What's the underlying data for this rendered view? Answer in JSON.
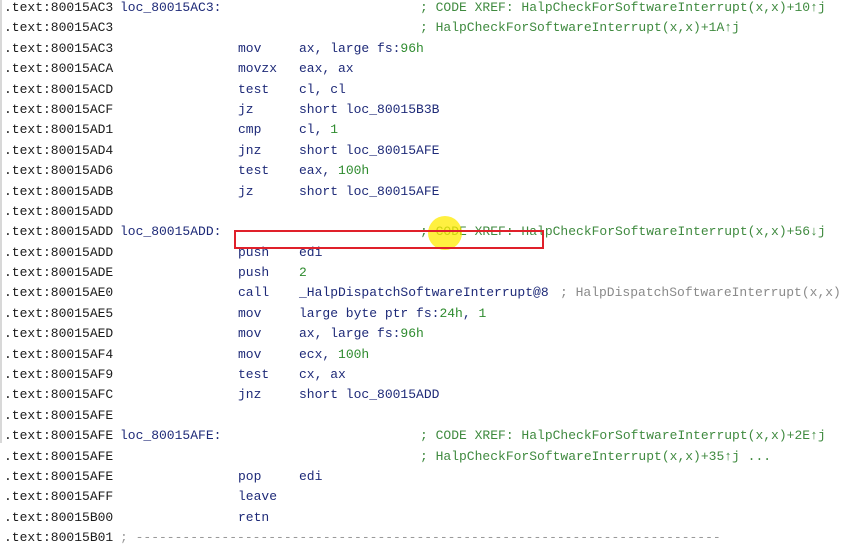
{
  "colors": {
    "address": "#1a1a1a",
    "mnemonic": "#1e2a78",
    "number": "#2e8b2e",
    "comment": "#3f8a3f",
    "highlight_box": "#e0202a",
    "cursor_highlight": "#ffeb00"
  },
  "lines": [
    {
      "addr": ".text:80015AC3",
      "label": "loc_80015AC3:",
      "mnem": "",
      "ops": [],
      "comment": "; CODE XREF: HalpCheckForSoftwareInterrupt(x,x)+10↑j"
    },
    {
      "addr": ".text:80015AC3",
      "label": "",
      "mnem": "",
      "ops": [],
      "comment": "; HalpCheckForSoftwareInterrupt(x,x)+1A↑j"
    },
    {
      "addr": ".text:80015AC3",
      "label": "",
      "mnem": "mov",
      "ops": [
        {
          "t": "ax, large fs:",
          "c": "op"
        },
        {
          "t": "96h",
          "c": "num"
        }
      ],
      "comment": ""
    },
    {
      "addr": ".text:80015ACA",
      "label": "",
      "mnem": "movzx",
      "ops": [
        {
          "t": "eax, ax",
          "c": "op"
        }
      ],
      "comment": ""
    },
    {
      "addr": ".text:80015ACD",
      "label": "",
      "mnem": "test",
      "ops": [
        {
          "t": "cl, cl",
          "c": "op"
        }
      ],
      "comment": ""
    },
    {
      "addr": ".text:80015ACF",
      "label": "",
      "mnem": "jz",
      "ops": [
        {
          "t": "short loc_80015B3B",
          "c": "op"
        }
      ],
      "comment": ""
    },
    {
      "addr": ".text:80015AD1",
      "label": "",
      "mnem": "cmp",
      "ops": [
        {
          "t": "cl, ",
          "c": "op"
        },
        {
          "t": "1",
          "c": "num"
        }
      ],
      "comment": ""
    },
    {
      "addr": ".text:80015AD4",
      "label": "",
      "mnem": "jnz",
      "ops": [
        {
          "t": "short loc_80015AFE",
          "c": "op"
        }
      ],
      "comment": ""
    },
    {
      "addr": ".text:80015AD6",
      "label": "",
      "mnem": "test",
      "ops": [
        {
          "t": "eax, ",
          "c": "op"
        },
        {
          "t": "100h",
          "c": "num"
        }
      ],
      "comment": ""
    },
    {
      "addr": ".text:80015ADB",
      "label": "",
      "mnem": "jz",
      "ops": [
        {
          "t": "short loc_80015AFE",
          "c": "op"
        }
      ],
      "comment": ""
    },
    {
      "addr": ".text:80015ADD",
      "label": "",
      "mnem": "",
      "ops": [],
      "comment": ""
    },
    {
      "addr": ".text:80015ADD",
      "label": "loc_80015ADD:",
      "mnem": "",
      "ops": [],
      "comment": "; CODE XREF: HalpCheckForSoftwareInterrupt(x,x)+56↓j"
    },
    {
      "addr": ".text:80015ADD",
      "label": "",
      "mnem": "push",
      "ops": [
        {
          "t": "edi",
          "c": "op"
        }
      ],
      "comment": ""
    },
    {
      "addr": ".text:80015ADE",
      "label": "",
      "mnem": "push",
      "ops": [
        {
          "t": "2",
          "c": "num"
        }
      ],
      "comment": ""
    },
    {
      "addr": ".text:80015AE0",
      "label": "",
      "mnem": "call",
      "ops": [
        {
          "t": "_HalpDispatchSoftwareInterrupt@8",
          "c": "sym"
        }
      ],
      "comment": "; HalpDispatchSoftwareInterrupt(x,x)",
      "comment_style": "gray"
    },
    {
      "addr": ".text:80015AE5",
      "label": "",
      "mnem": "mov",
      "ops": [
        {
          "t": "large byte ptr fs:",
          "c": "op"
        },
        {
          "t": "24h",
          "c": "num"
        },
        {
          "t": ", ",
          "c": "op"
        },
        {
          "t": "1",
          "c": "num"
        }
      ],
      "comment": ""
    },
    {
      "addr": ".text:80015AED",
      "label": "",
      "mnem": "mov",
      "ops": [
        {
          "t": "ax, large fs:",
          "c": "op"
        },
        {
          "t": "96h",
          "c": "num"
        }
      ],
      "comment": ""
    },
    {
      "addr": ".text:80015AF4",
      "label": "",
      "mnem": "mov",
      "ops": [
        {
          "t": "ecx, ",
          "c": "op"
        },
        {
          "t": "100h",
          "c": "num"
        }
      ],
      "comment": ""
    },
    {
      "addr": ".text:80015AF9",
      "label": "",
      "mnem": "test",
      "ops": [
        {
          "t": "cx, ax",
          "c": "op"
        }
      ],
      "comment": ""
    },
    {
      "addr": ".text:80015AFC",
      "label": "",
      "mnem": "jnz",
      "ops": [
        {
          "t": "short loc_80015ADD",
          "c": "op"
        }
      ],
      "comment": ""
    },
    {
      "addr": ".text:80015AFE",
      "label": "",
      "mnem": "",
      "ops": [],
      "comment": ""
    },
    {
      "addr": ".text:80015AFE",
      "label": "loc_80015AFE:",
      "mnem": "",
      "ops": [],
      "comment": "; CODE XREF: HalpCheckForSoftwareInterrupt(x,x)+2E↑j"
    },
    {
      "addr": ".text:80015AFE",
      "label": "",
      "mnem": "",
      "ops": [],
      "comment": "; HalpCheckForSoftwareInterrupt(x,x)+35↑j ..."
    },
    {
      "addr": ".text:80015AFE",
      "label": "",
      "mnem": "pop",
      "ops": [
        {
          "t": "edi",
          "c": "op"
        }
      ],
      "comment": ""
    },
    {
      "addr": ".text:80015AFF",
      "label": "",
      "mnem": "leave",
      "ops": [],
      "comment": ""
    },
    {
      "addr": ".text:80015B00",
      "label": "",
      "mnem": "retn",
      "ops": [],
      "comment": ""
    },
    {
      "addr": ".text:80015B01",
      "label": "",
      "mnem": "",
      "ops": [],
      "comment": "; ---------------------------------------------------------------------------",
      "comment_style": "sep"
    }
  ]
}
